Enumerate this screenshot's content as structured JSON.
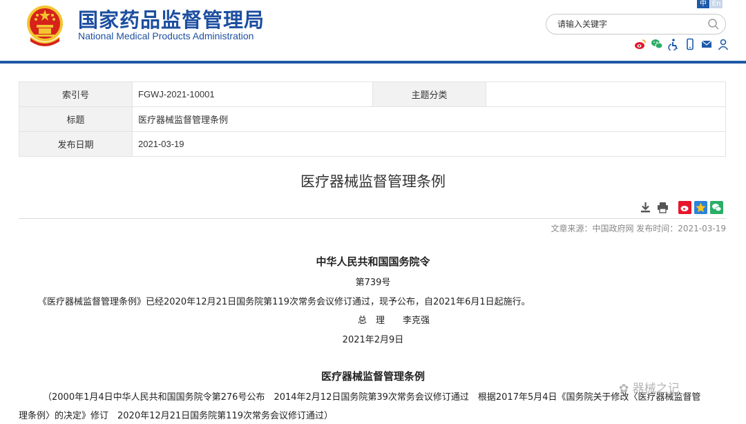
{
  "header": {
    "title_cn": "国家药品监督管理局",
    "title_en": "National Medical Products Administration",
    "lang_zh": "中",
    "lang_en": "En",
    "search_placeholder": "请输入关键字",
    "social_icons": [
      "weibo-icon",
      "wechat-icon",
      "accessibility-icon",
      "mobile-icon",
      "mail-icon",
      "user-icon"
    ]
  },
  "info": {
    "index_label": "索引号",
    "index_value": "FGWJ-2021-10001",
    "topic_label": "主题分类",
    "topic_value": "",
    "title_label": "标题",
    "title_value": "医疗器械监督管理条例",
    "date_label": "发布日期",
    "date_value": "2021-03-19"
  },
  "article": {
    "title": "医疗器械监督管理条例",
    "source_line": "文章来源：中国政府网 发布时间：2021-03-19",
    "order_title": "中华人民共和国国务院令",
    "order_no": "第739号",
    "order_text": "《医疗器械监督管理条例》已经2020年12月21日国务院第119次常务会议修订通过，现予公布，自2021年6月1日起施行。",
    "signature": "总　理　　李克强",
    "sign_date": "2021年2月9日",
    "regulation_title": "医疗器械监督管理条例",
    "history_line1": "（2000年1月4日中华人民共和国国务院令第276号公布　2014年2月12日国务院第39次常务会议修订通过　根据2017年5月4日《国务院关于修改〈医疗器械监督管",
    "history_line2": "理条例〉的决定》修订　2020年12月21日国务院第119次常务会议修订通过）"
  },
  "tools": [
    "download-icon",
    "print-icon",
    "share-weibo-icon",
    "share-qzone-icon",
    "share-wechat-icon"
  ],
  "watermark": "器械之记",
  "colors": {
    "brand_blue": "#1d4fa0",
    "bar_blue": "#1f57a4",
    "emblem_red": "#d6221b",
    "emblem_gold": "#f4c430"
  }
}
